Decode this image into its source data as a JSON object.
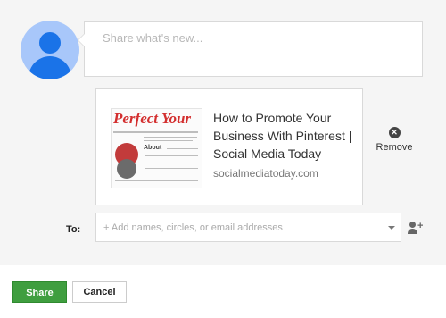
{
  "composer": {
    "placeholder": "Share what's new..."
  },
  "link_preview": {
    "thumbnail_title": "Perfect Your",
    "thumbnail_label": "About",
    "title": "How to Promote Your Business With Pinterest | Social Media Today",
    "domain": "socialmediatoday.com"
  },
  "remove": {
    "label": "Remove"
  },
  "recipients": {
    "label": "To:",
    "placeholder": "+ Add names, circles, or email addresses"
  },
  "actions": {
    "share_label": "Share",
    "cancel_label": "Cancel",
    "share_color": "#3f9e3f"
  }
}
